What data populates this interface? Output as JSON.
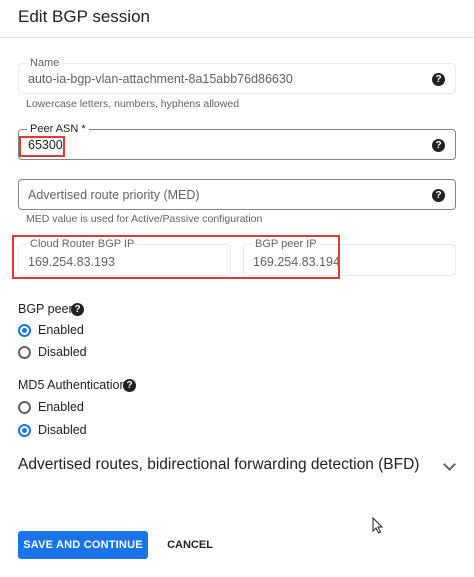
{
  "header": {
    "title": "Edit BGP session"
  },
  "name_field": {
    "label": "Name",
    "value": "auto-ia-bgp-vlan-attachment-8a15abb76d86630",
    "hint": "Lowercase letters, numbers, hyphens allowed",
    "help_icon": "question-mark-icon"
  },
  "peer_asn_field": {
    "label": "Peer ASN *",
    "value": "65300",
    "help_icon": "question-mark-icon"
  },
  "med_field": {
    "placeholder": "Advertised route priority (MED)",
    "hint": "MED value is used for Active/Passive configuration",
    "help_icon": "question-mark-icon"
  },
  "cloud_router_ip": {
    "label": "Cloud Router BGP IP",
    "value": "169.254.83.193"
  },
  "bgp_peer_ip": {
    "label": "BGP peer IP",
    "value": "169.254.83.194"
  },
  "bgp_peer": {
    "label": "BGP peer",
    "options": [
      {
        "label": "Enabled",
        "selected": true
      },
      {
        "label": "Disabled",
        "selected": false
      }
    ]
  },
  "md5": {
    "label": "MD5 Authentication",
    "options": [
      {
        "label": "Enabled",
        "selected": false
      },
      {
        "label": "Disabled",
        "selected": true
      }
    ]
  },
  "advanced": {
    "title": "Advertised routes, bidirectional forwarding detection (BFD)",
    "icon": "chevron-down-icon"
  },
  "actions": {
    "save_label": "SAVE AND CONTINUE",
    "cancel_label": "CANCEL"
  },
  "colors": {
    "accent": "#1a73e8",
    "highlight": "#e53935"
  }
}
